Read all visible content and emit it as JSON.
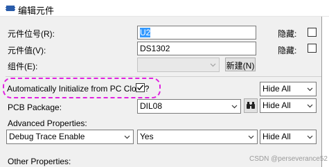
{
  "titlebar": {
    "title": "编辑元件",
    "icon": "component-edit-icon"
  },
  "refdes": {
    "label": "元件位号(R):",
    "value": "U2",
    "hidden_label": "隐藏:"
  },
  "value": {
    "label": "元件值(V):",
    "value": "DS1302",
    "hidden_label": "隐藏:"
  },
  "group": {
    "label": "组件(E):",
    "value": "",
    "new_button": "新建(N)"
  },
  "auto_init": {
    "label": "Automatically Initialize from PC Clock?",
    "checked": true,
    "visibility": "Hide All"
  },
  "pcb_package": {
    "label": "PCB Package:",
    "value": "DIL08",
    "visibility": "Hide All",
    "picker_icon": "binoculars-icon"
  },
  "advanced": {
    "label": "Advanced Properties:",
    "property": "Debug Trace Enable",
    "value": "Yes",
    "visibility": "Hide All"
  },
  "other": {
    "label": "Other Properties:"
  },
  "watermark": "CSDN @perseverance52",
  "colors": {
    "highlight": "#e020e0",
    "selection": "#3399ff"
  }
}
